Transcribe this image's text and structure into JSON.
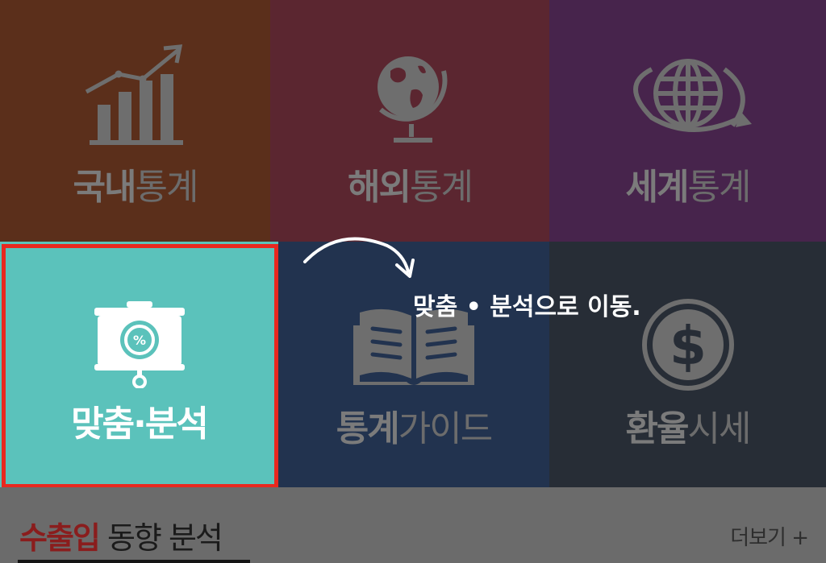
{
  "colors": {
    "domestic_bg": "#5b2f1b",
    "overseas_bg": "#5b2630",
    "world_bg": "#47244c",
    "custom_bg": "#5bc2bb",
    "guide_bg": "#22334f",
    "exchange_bg": "#272d36",
    "dim_icon": "#6e6e6e",
    "dim_label_strong": "#7b7b7b",
    "dim_label_light": "#6c6c6c",
    "accent_red": "#8a1d1d",
    "highlight_border": "#e8281f",
    "white": "#ffffff"
  },
  "tiles": {
    "domestic": {
      "label_bold": "국내",
      "label_rest": "통계",
      "icon": "bar-chart-icon"
    },
    "overseas": {
      "label_bold": "해외",
      "label_rest": "통계",
      "icon": "globe-icon"
    },
    "world": {
      "label_bold": "세계",
      "label_rest": "통계",
      "icon": "world-network-icon"
    },
    "custom": {
      "label": "맞춤·분석",
      "icon": "presentation-board-icon"
    },
    "guide": {
      "label_bold": "통계",
      "label_rest": "가이드",
      "icon": "open-book-icon"
    },
    "exchange": {
      "label_bold": "환율",
      "label_rest": "시세",
      "icon": "dollar-coin-icon"
    }
  },
  "section": {
    "title_accent": "수출입",
    "title_rest": " 동향 분석",
    "more_label": "더보기 +"
  },
  "annotation": {
    "text": "맞춤 • 분석으로 이동."
  }
}
